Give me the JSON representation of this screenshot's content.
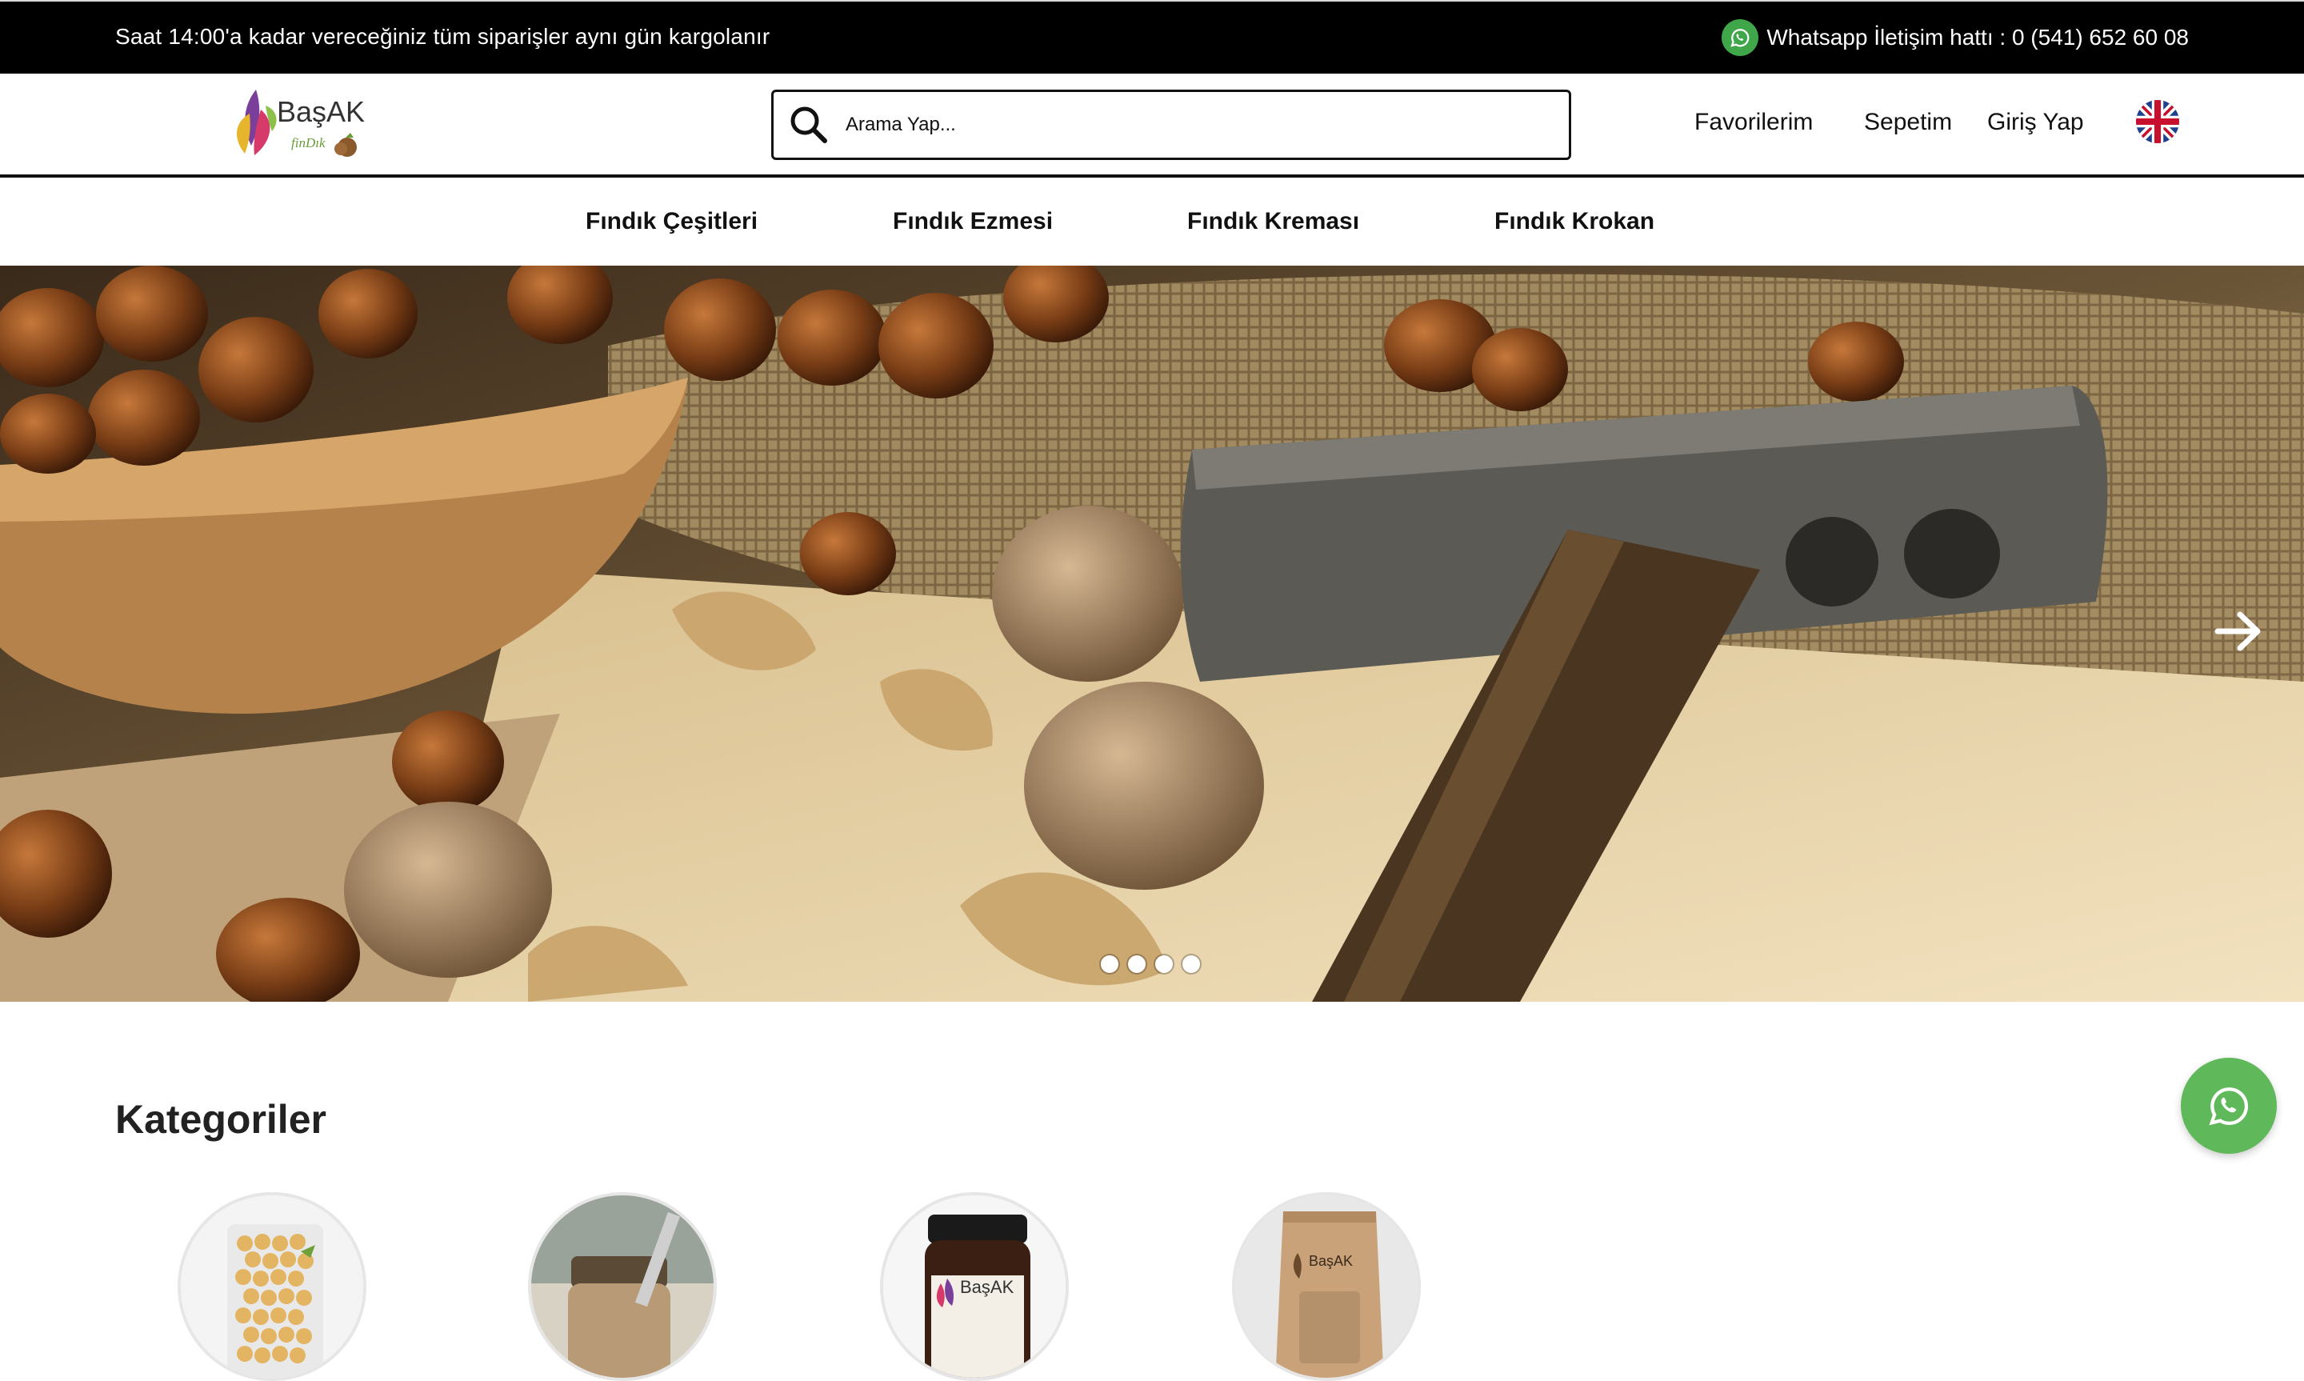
{
  "topbar": {
    "notice": "Saat 14:00'a kadar vereceğiniz tüm siparişler aynı gün kargolanır",
    "whatsapp_line": "Whatsapp İletişim hattı : 0 (541) 652 60 08"
  },
  "header": {
    "logo_text": "BaşAK",
    "logo_sub": "finDık",
    "search_placeholder": "Arama Yap...",
    "links": [
      "Favorilerim",
      "Sepetim",
      "Giriş Yap"
    ],
    "language_icon": "uk-flag-icon"
  },
  "nav": {
    "items": [
      "Fındık Çeşitleri",
      "Fındık Ezmesi",
      "Fındık Kreması",
      "Fındık Krokan"
    ]
  },
  "hero": {
    "slide_count": 4,
    "next_icon": "arrow-right-icon"
  },
  "categories": {
    "title": "Kategoriler",
    "items": [
      {
        "image": "hazelnut-bag"
      },
      {
        "image": "hazelnut-paste-jar"
      },
      {
        "image": "hazelnut-cream-jar",
        "label": "BaşAK"
      },
      {
        "image": "kraft-pouch",
        "label": "BaşAK"
      }
    ]
  },
  "colors": {
    "topbar_bg": "#000000",
    "whatsapp_green": "#5fb95a",
    "text": "#111111"
  }
}
